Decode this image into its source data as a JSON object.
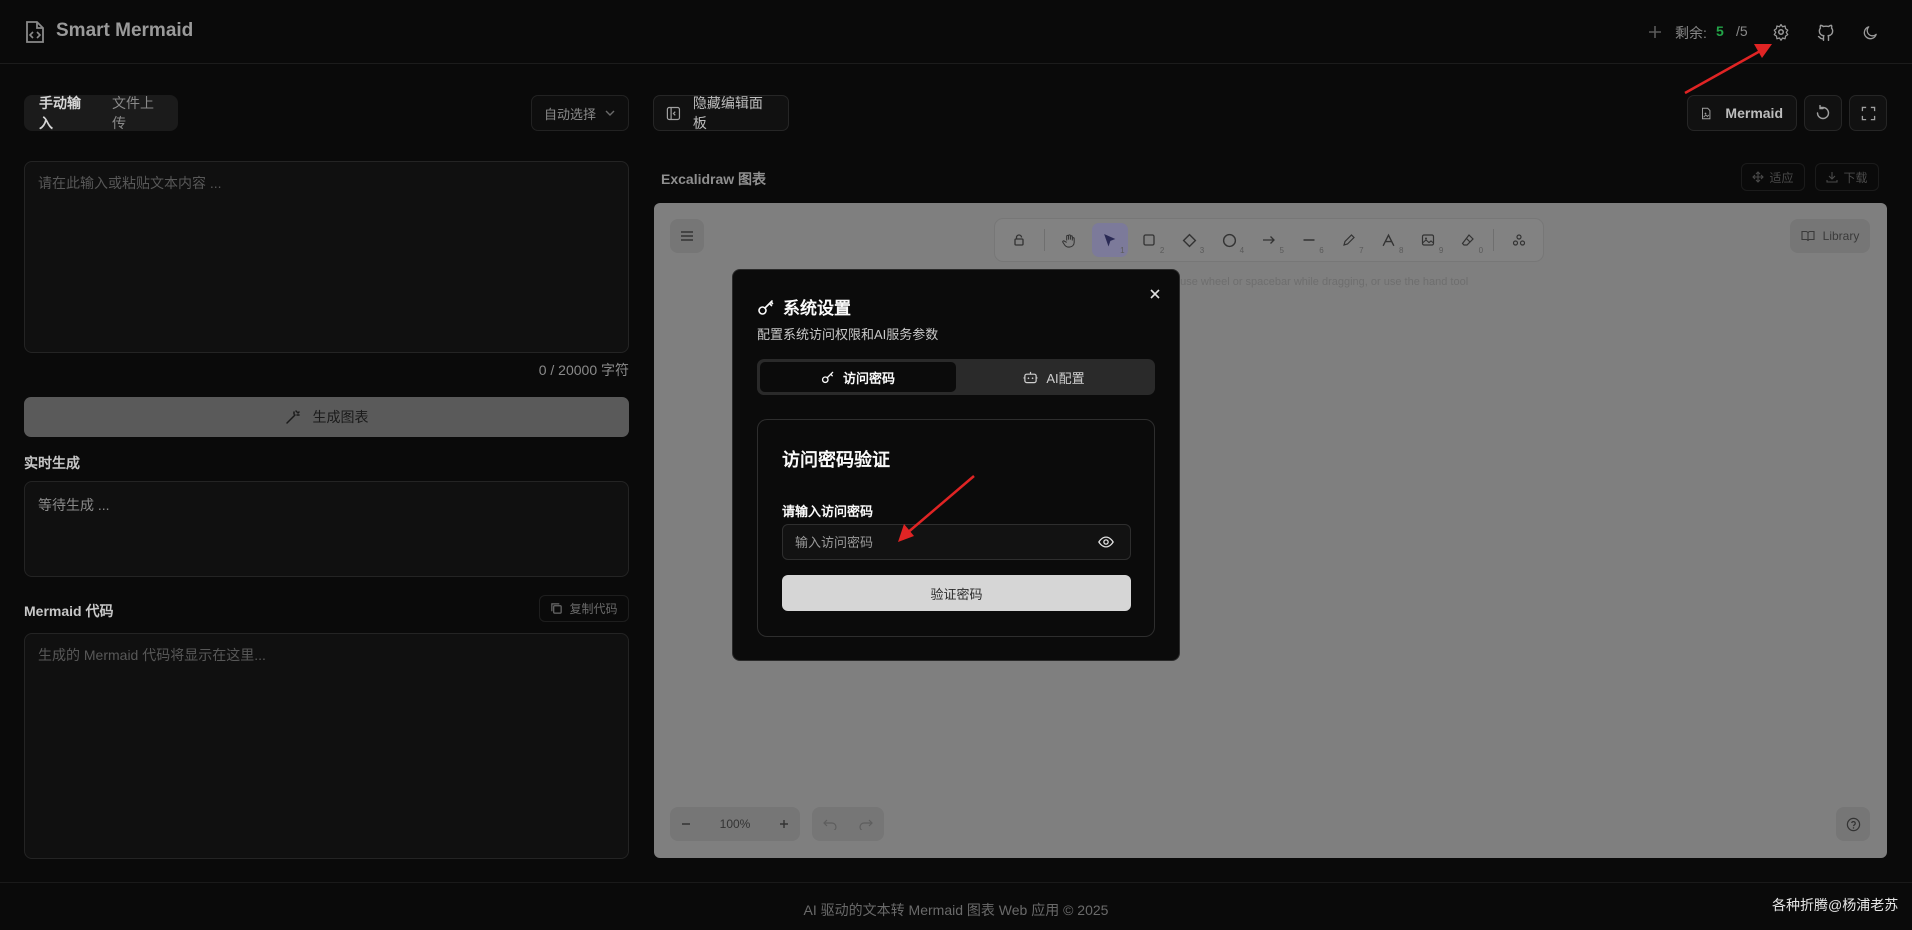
{
  "header": {
    "title": "Smart Mermaid",
    "remaining_label": "剩余:",
    "remaining_value": "5",
    "remaining_total": "/5"
  },
  "left": {
    "tabs": [
      {
        "label": "手动输入",
        "active": true
      },
      {
        "label": "文件上传",
        "active": false
      }
    ],
    "auto_select": "自动选择",
    "input_placeholder": "请在此输入或粘贴文本内容 ...",
    "char_count": "0 / 20000 字符",
    "generate_label": "生成图表",
    "realtime_label": "实时生成",
    "realtime_text": "等待生成 ...",
    "mermaid_label": "Mermaid 代码",
    "copy_label": "复制代码",
    "mermaid_placeholder": "生成的 Mermaid 代码将显示在这里..."
  },
  "right": {
    "hide_panel_label": "隐藏编辑面板",
    "mermaid_button": "Mermaid",
    "canvas_title": "Excalidraw 图表",
    "fit_label": "适应",
    "download_label": "下载",
    "hint": "ouse wheel or spacebar while dragging, or use the hand tool",
    "library_label": "Library",
    "zoom": "100%",
    "tool_numbers": [
      "1",
      "2",
      "3",
      "4",
      "5",
      "6",
      "7",
      "8",
      "9",
      "0"
    ]
  },
  "modal": {
    "title": "系统设置",
    "description": "配置系统访问权限和AI服务参数",
    "tabs": [
      {
        "label": "访问密码",
        "active": true
      },
      {
        "label": "AI配置",
        "active": false
      }
    ],
    "card_title": "访问密码验证",
    "password_label": "请输入访问密码",
    "password_placeholder": "输入访问密码",
    "verify_label": "验证密码"
  },
  "footer": {
    "text": "AI 驱动的文本转 Mermaid 图表 Web 应用 © 2025",
    "watermark": "各种折腾@杨浦老苏"
  },
  "colors": {
    "accent_green": "#22a447",
    "annotation_red": "#e02424"
  }
}
